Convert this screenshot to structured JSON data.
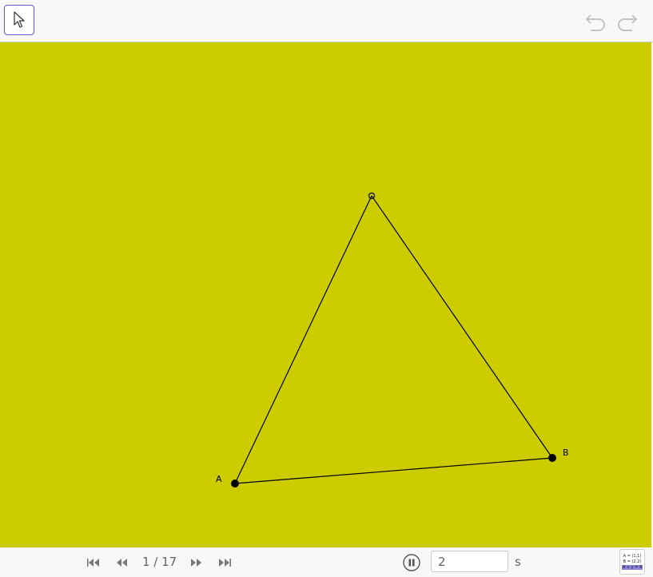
{
  "toolbar": {
    "tool_icon": "arrow-cursor-icon",
    "undo_icon": "undo-icon",
    "redo_icon": "redo-icon"
  },
  "canvas": {
    "background": "#cccc00",
    "points": [
      {
        "label": "A",
        "filled": true
      },
      {
        "label": "B",
        "filled": true
      },
      {
        "label": "",
        "filled": false
      }
    ]
  },
  "navigation": {
    "page_counter": "1 / 17",
    "first_icon": "skip-to-start-icon",
    "prev_icon": "step-back-icon",
    "next_icon": "step-forward-icon",
    "last_icon": "skip-to-end-icon",
    "pause_icon": "pause-icon",
    "speed_value": "2",
    "speed_unit": "s"
  },
  "algebra_button": {
    "lines": [
      "A = (1,1)",
      "B = (2,2)",
      "A + y = 4"
    ]
  }
}
